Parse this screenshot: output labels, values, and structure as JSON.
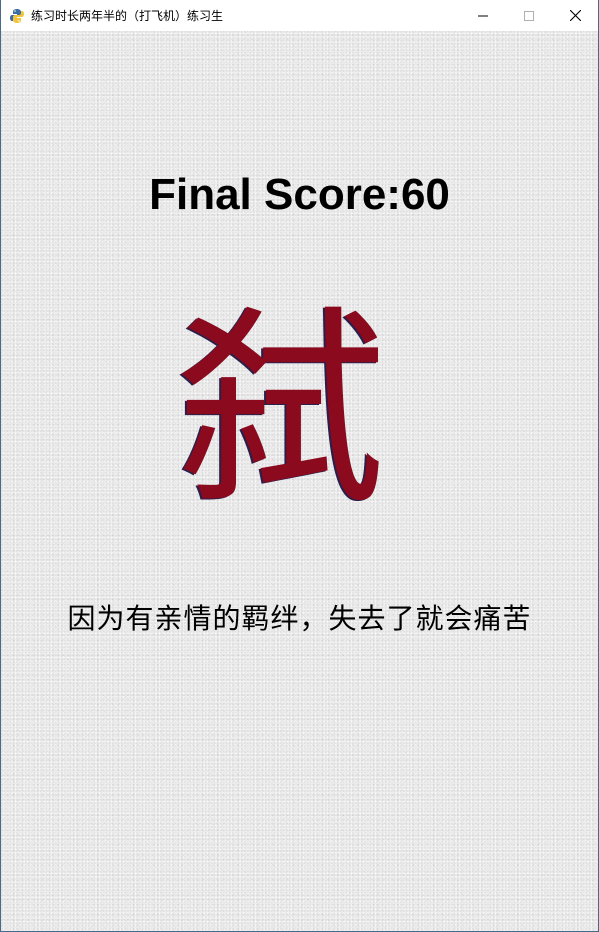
{
  "window": {
    "title": "练习时长两年半的（打飞机）练习生",
    "app_icon": "python-snake-icon",
    "controls": [
      "minimize-icon",
      "maximize-icon",
      "close-icon"
    ]
  },
  "game": {
    "score_text": "Final Score:60",
    "score_value": 60,
    "big_character": "弑",
    "subtitle": "因为有亲情的羁绊，失去了就会痛苦"
  },
  "colors": {
    "character": "#8b0a1e",
    "character_shadow": "#2a1f4a",
    "background": "#ececec",
    "text": "#000000"
  }
}
